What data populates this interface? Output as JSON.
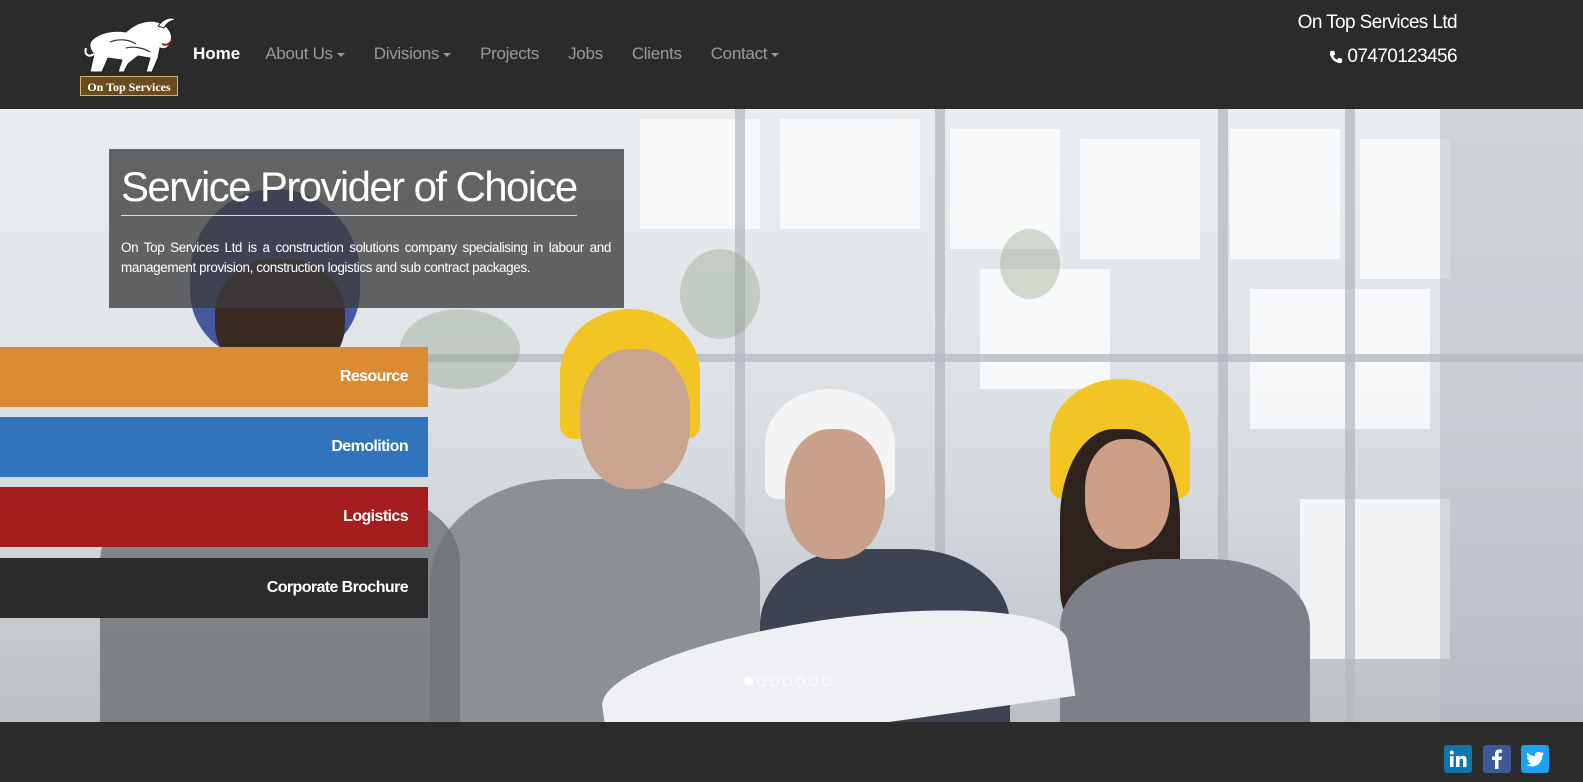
{
  "header": {
    "logo_text": "On Top Services",
    "nav": [
      {
        "label": "Home",
        "active": true,
        "dropdown": false
      },
      {
        "label": "About Us",
        "active": false,
        "dropdown": true
      },
      {
        "label": "Divisions",
        "active": false,
        "dropdown": true
      },
      {
        "label": "Projects",
        "active": false,
        "dropdown": false
      },
      {
        "label": "Jobs",
        "active": false,
        "dropdown": false
      },
      {
        "label": "Clients",
        "active": false,
        "dropdown": false
      },
      {
        "label": "Contact",
        "active": false,
        "dropdown": true
      }
    ],
    "company_name": "On Top Services Ltd",
    "phone": "07470123456",
    "phone_icon": "phone-icon"
  },
  "hero": {
    "title": "Service Provider of Choice",
    "description": "On Top Services Ltd is a construction solutions company specialising in labour and management provision, construction logistics and sub contract packages.",
    "divisions": [
      {
        "label": "Resource",
        "color": "#db8b33"
      },
      {
        "label": "Demolition",
        "color": "#3274bb"
      },
      {
        "label": "Logistics",
        "color": "#a51c1e"
      },
      {
        "label": "Corporate Brochure",
        "color": "#2b2b2b"
      }
    ],
    "slides": {
      "count": 7,
      "active_index": 0
    }
  },
  "footer": {
    "social": [
      {
        "icon": "linkedin-icon",
        "color": "#0e76a8"
      },
      {
        "icon": "facebook-icon",
        "color": "#3b5998"
      },
      {
        "icon": "twitter-icon",
        "color": "#1da1f2"
      }
    ]
  },
  "colors": {
    "header_bg": "#2b2b2b",
    "nav_active": "#ffffff",
    "nav_inactive": "#9a9a9a"
  }
}
